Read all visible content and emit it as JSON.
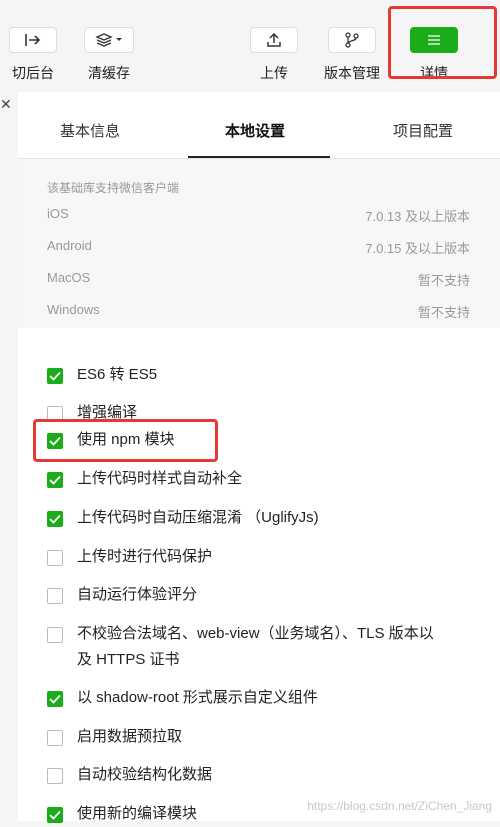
{
  "toolbar": {
    "background": "切后台",
    "clear_cache": "清缓存",
    "upload": "上传",
    "version": "版本管理",
    "details": "详情"
  },
  "tabs": [
    "基本信息",
    "本地设置",
    "项目配置"
  ],
  "base_lib": {
    "title": "该基础库支持微信客户端",
    "rows": [
      {
        "k": "iOS",
        "v": "7.0.13 及以上版本"
      },
      {
        "k": "Android",
        "v": "7.0.15 及以上版本"
      },
      {
        "k": "MacOS",
        "v": "暂不支持"
      },
      {
        "k": "Windows",
        "v": "暂不支持"
      }
    ]
  },
  "options": [
    {
      "label": "ES6 转 ES5",
      "checked": true
    },
    {
      "label": "增强编译",
      "checked": false
    },
    {
      "label": "使用 npm 模块",
      "checked": true
    },
    {
      "label": "上传代码时样式自动补全",
      "checked": true
    },
    {
      "label": "上传代码时自动压缩混淆 （UglifyJs)",
      "checked": true
    },
    {
      "label": "上传时进行代码保护",
      "checked": false
    },
    {
      "label": "自动运行体验评分",
      "checked": false
    },
    {
      "label": "不校验合法域名、web-view（业务域名）、TLS 版本以及 HTTPS 证书",
      "checked": false
    },
    {
      "label": "以 shadow-root 形式展示自定义组件",
      "checked": true
    },
    {
      "label": "启用数据预拉取",
      "checked": false
    },
    {
      "label": "自动校验结构化数据",
      "checked": false
    },
    {
      "label": "使用新的编译模块",
      "checked": true
    }
  ],
  "watermark": "https://blog.csdn.net/ZiChen_Jiang",
  "colors": {
    "accent": "#1aad19",
    "highlight": "#e53935"
  }
}
